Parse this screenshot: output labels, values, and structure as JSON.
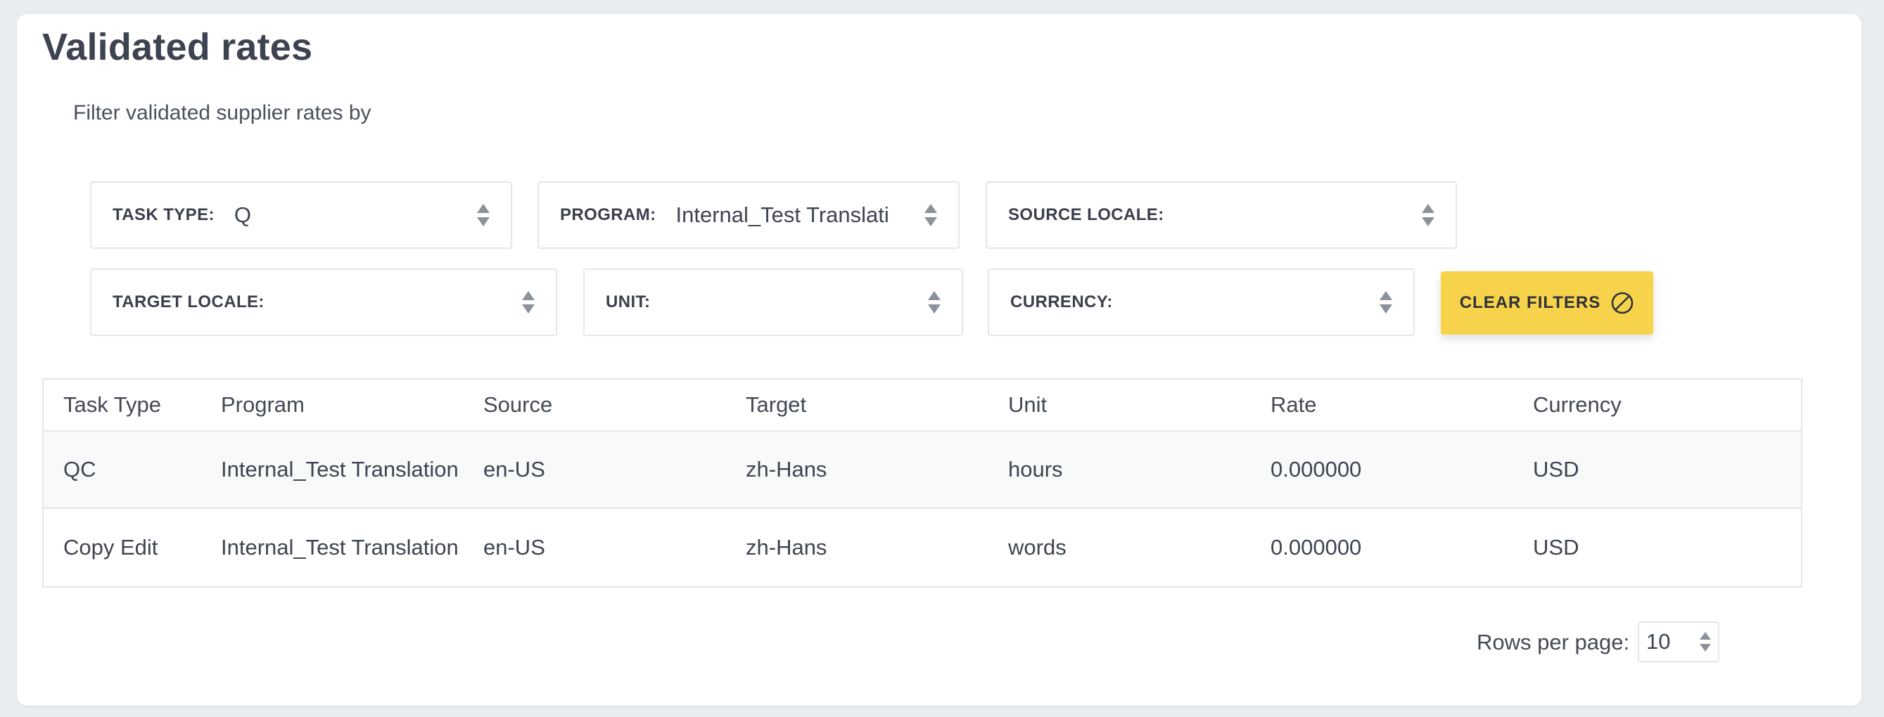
{
  "page": {
    "title": "Validated rates",
    "filter_intro": "Filter validated supplier rates by"
  },
  "filters": {
    "task_type": {
      "label": "TASK TYPE:",
      "value": "Q"
    },
    "program": {
      "label": "PROGRAM:",
      "value": "Internal_Test Translati"
    },
    "source_locale": {
      "label": "SOURCE LOCALE:",
      "value": ""
    },
    "target_locale": {
      "label": "TARGET LOCALE:",
      "value": ""
    },
    "unit": {
      "label": "UNIT:",
      "value": ""
    },
    "currency": {
      "label": "CURRENCY:",
      "value": ""
    },
    "clear_label": "CLEAR FILTERS"
  },
  "table": {
    "headers": [
      "Task Type",
      "Program",
      "Source",
      "Target",
      "Unit",
      "Rate",
      "Currency"
    ],
    "rows": [
      [
        "QC",
        "Internal_Test Translation",
        "en-US",
        "zh-Hans",
        "hours",
        "0.000000",
        "USD"
      ],
      [
        "Copy Edit",
        "Internal_Test Translation",
        "en-US",
        "zh-Hans",
        "words",
        "0.000000",
        "USD"
      ]
    ]
  },
  "pagination": {
    "rows_per_page_label": "Rows per page:",
    "rows_per_page_value": "10"
  },
  "colors": {
    "accent": "#f7d24b",
    "background": "#e9edf0",
    "card": "#ffffff",
    "border": "#e4e7ea"
  }
}
